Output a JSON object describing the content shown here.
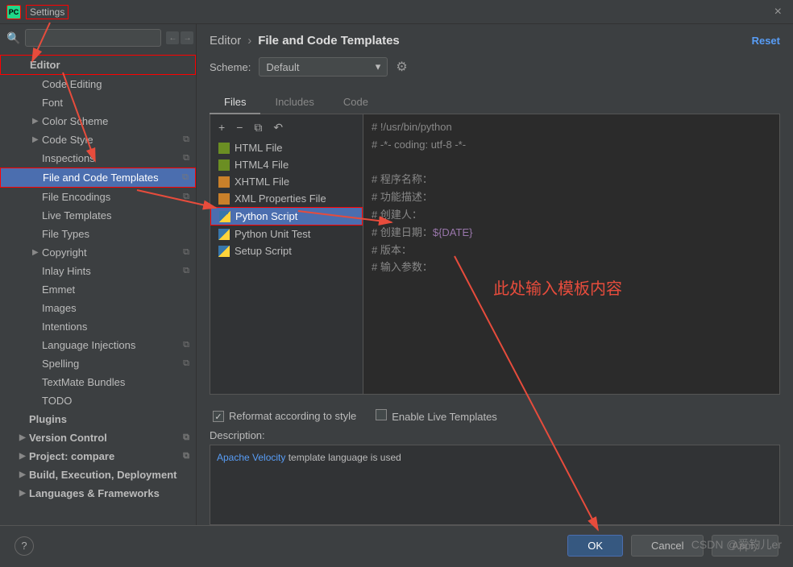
{
  "window": {
    "title": "Settings"
  },
  "search": {
    "placeholder": ""
  },
  "sidebar": {
    "items": [
      {
        "label": "Editor",
        "bold": true,
        "indent": 1,
        "chev": "",
        "redbox": true
      },
      {
        "label": "Code Editing",
        "indent": 2
      },
      {
        "label": "Font",
        "indent": 2
      },
      {
        "label": "Color Scheme",
        "indent": 2,
        "chev": "▶"
      },
      {
        "label": "Code Style",
        "indent": 2,
        "chev": "▶",
        "copy": true
      },
      {
        "label": "Inspections",
        "indent": 2,
        "copy": true
      },
      {
        "label": "File and Code Templates",
        "indent": 2,
        "copy": true,
        "selected": true,
        "redbox": true
      },
      {
        "label": "File Encodings",
        "indent": 2,
        "copy": true
      },
      {
        "label": "Live Templates",
        "indent": 2
      },
      {
        "label": "File Types",
        "indent": 2
      },
      {
        "label": "Copyright",
        "indent": 2,
        "chev": "▶",
        "copy": true
      },
      {
        "label": "Inlay Hints",
        "indent": 2,
        "copy": true
      },
      {
        "label": "Emmet",
        "indent": 2
      },
      {
        "label": "Images",
        "indent": 2
      },
      {
        "label": "Intentions",
        "indent": 2
      },
      {
        "label": "Language Injections",
        "indent": 2,
        "copy": true
      },
      {
        "label": "Spelling",
        "indent": 2,
        "copy": true
      },
      {
        "label": "TextMate Bundles",
        "indent": 2
      },
      {
        "label": "TODO",
        "indent": 2
      },
      {
        "label": "Plugins",
        "bold": true,
        "indent": 1
      },
      {
        "label": "Version Control",
        "bold": true,
        "indent": 1,
        "chev": "▶",
        "copy": true
      },
      {
        "label": "Project: compare",
        "bold": true,
        "indent": 1,
        "chev": "▶",
        "copy": true
      },
      {
        "label": "Build, Execution, Deployment",
        "bold": true,
        "indent": 1,
        "chev": "▶"
      },
      {
        "label": "Languages & Frameworks",
        "bold": true,
        "indent": 1,
        "chev": "▶"
      }
    ]
  },
  "breadcrumb": {
    "parent": "Editor",
    "current": "File and Code Templates",
    "reset": "Reset"
  },
  "scheme": {
    "label": "Scheme:",
    "value": "Default"
  },
  "tabs": [
    {
      "label": "Files",
      "active": true
    },
    {
      "label": "Includes"
    },
    {
      "label": "Code"
    }
  ],
  "toolbar": {
    "add": "+",
    "remove": "−",
    "copy": "⧉",
    "undo": "↶"
  },
  "templates": [
    {
      "label": "HTML File",
      "icon": "icon-html"
    },
    {
      "label": "HTML4 File",
      "icon": "icon-html"
    },
    {
      "label": "XHTML File",
      "icon": "icon-xml"
    },
    {
      "label": "XML Properties File",
      "icon": "icon-xml"
    },
    {
      "label": "Python Script",
      "icon": "icon-py",
      "selected": true,
      "redbox": true
    },
    {
      "label": "Python Unit Test",
      "icon": "icon-py"
    },
    {
      "label": "Setup Script",
      "icon": "icon-py"
    }
  ],
  "editor": {
    "l1": "# !/usr/bin/python",
    "l2": "# -*- coding: utf-8 -*-",
    "l3": "",
    "l4": "# 程序名称：",
    "l5": "# 功能描述：",
    "l6": "# 创建人：",
    "l7a": "# 创建日期：",
    "l7b": "${DATE}",
    "l8": "# 版本：",
    "l9": "# 输入参数："
  },
  "opts": {
    "reformat": "Reformat according to style",
    "live": "Enable Live Templates"
  },
  "desc": {
    "label": "Description:",
    "link": "Apache Velocity",
    "rest": " template language is used"
  },
  "footer": {
    "ok": "OK",
    "cancel": "Cancel",
    "apply": "Apply"
  },
  "annot": {
    "text": "此处输入模板内容"
  },
  "watermark": "CSDN @爱钓儿er"
}
